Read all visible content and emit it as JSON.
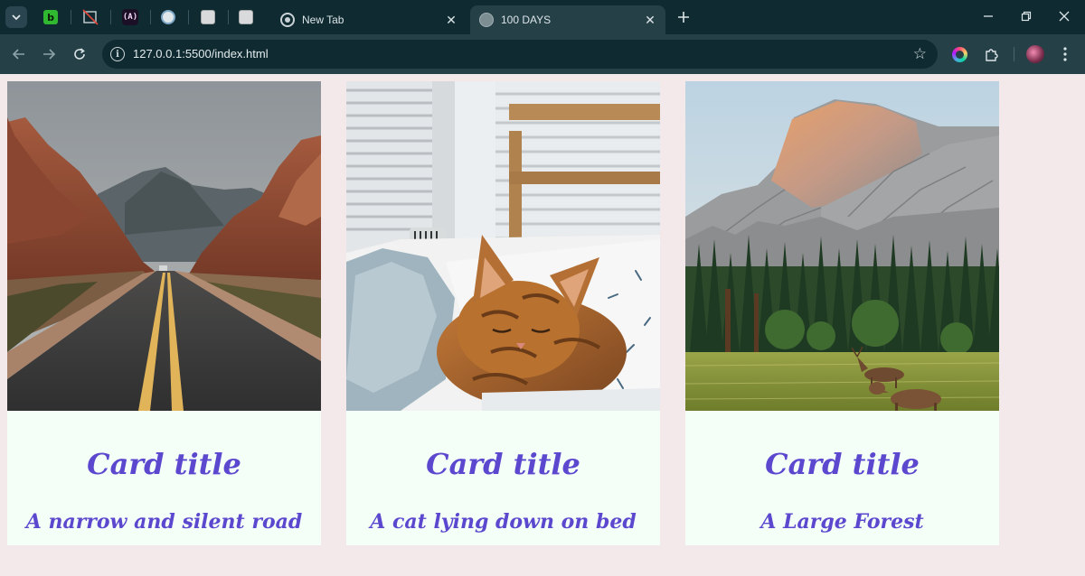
{
  "browser": {
    "tabs": [
      {
        "title": "New Tab",
        "favicon": "chrome-icon",
        "active": false
      },
      {
        "title": "100 DAYS",
        "favicon": "globe-icon",
        "active": true
      }
    ],
    "pinned_tabs": [
      {
        "favicon": "b-icon",
        "label": "b"
      },
      {
        "favicon": "no-image-icon"
      },
      {
        "favicon": "angular-icon",
        "label": "(A)"
      },
      {
        "favicon": "cube-icon"
      },
      {
        "favicon": "site-icon"
      },
      {
        "favicon": "site-icon"
      }
    ],
    "url": "127.0.0.1:5500/index.html",
    "colors": {
      "tabstrip": "#0f2a30",
      "toolbar": "#264048"
    }
  },
  "cards": [
    {
      "title": "Card title",
      "text": "A narrow and silent road",
      "image": "desert-road"
    },
    {
      "title": "Card title",
      "text": "A cat lying down on bed",
      "image": "sleeping-cat"
    },
    {
      "title": "Card title",
      "text": "A Large Forest",
      "image": "mountain-forest"
    }
  ],
  "theme": {
    "page_bg": "#f3e9ea",
    "card_bg": "#f4fff8",
    "accent": "#5b48cf"
  }
}
